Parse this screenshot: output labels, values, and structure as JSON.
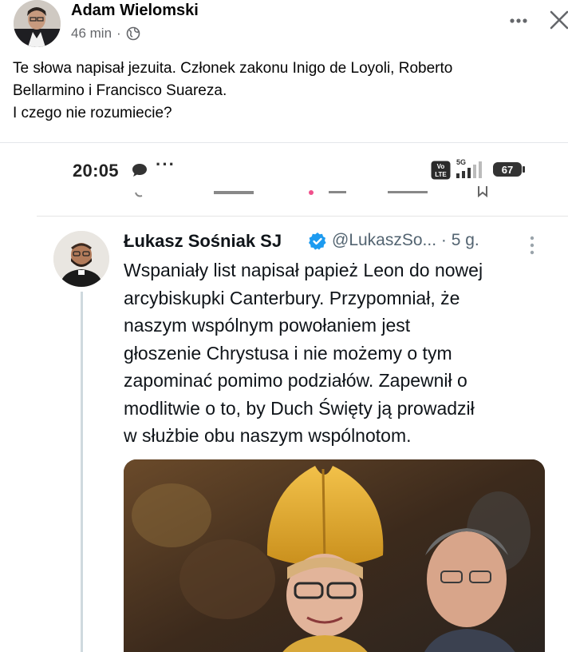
{
  "post": {
    "author": "Adam Wielomski",
    "time": "46 min",
    "separator": "·",
    "more_icon": "more-horizontal-icon",
    "close_icon": "close-icon",
    "privacy_icon": "globe-icon",
    "text_lines": [
      "Te słowa napisał jezuita. Członek zakonu Inigo de Loyoli, Roberto",
      "Bellarmino i Francisco Suareza.",
      "I czego nie rozumiecie?"
    ]
  },
  "screenshot": {
    "status_bar": {
      "time": "20:05",
      "dots": "···",
      "volte": "Vo LTE",
      "network": "5G",
      "battery": "67"
    },
    "tweet": {
      "name": "Łukasz Sośniak SJ",
      "handle_time": "@LukaszSo... · 5 g.",
      "body_lines": [
        "Wspaniały list napisał papież Leon do nowej",
        "arcybiskupki Canterbury. Przypomniał, że",
        "naszym wspólnym powołaniem jest",
        "głoszenie Chrystusa i nie możemy o tym",
        "zapominać pomimo podziałów. Zapewnił o",
        "modlitwie o to, by Duch Święty ją prowadził",
        "w służbie obu naszym wspólnotom."
      ]
    }
  },
  "colors": {
    "fb_text": "#050505",
    "fb_meta": "#65676b",
    "tw_text": "#0f1419",
    "tw_handle": "#536471",
    "verified_blue": "#1d9bf0"
  }
}
